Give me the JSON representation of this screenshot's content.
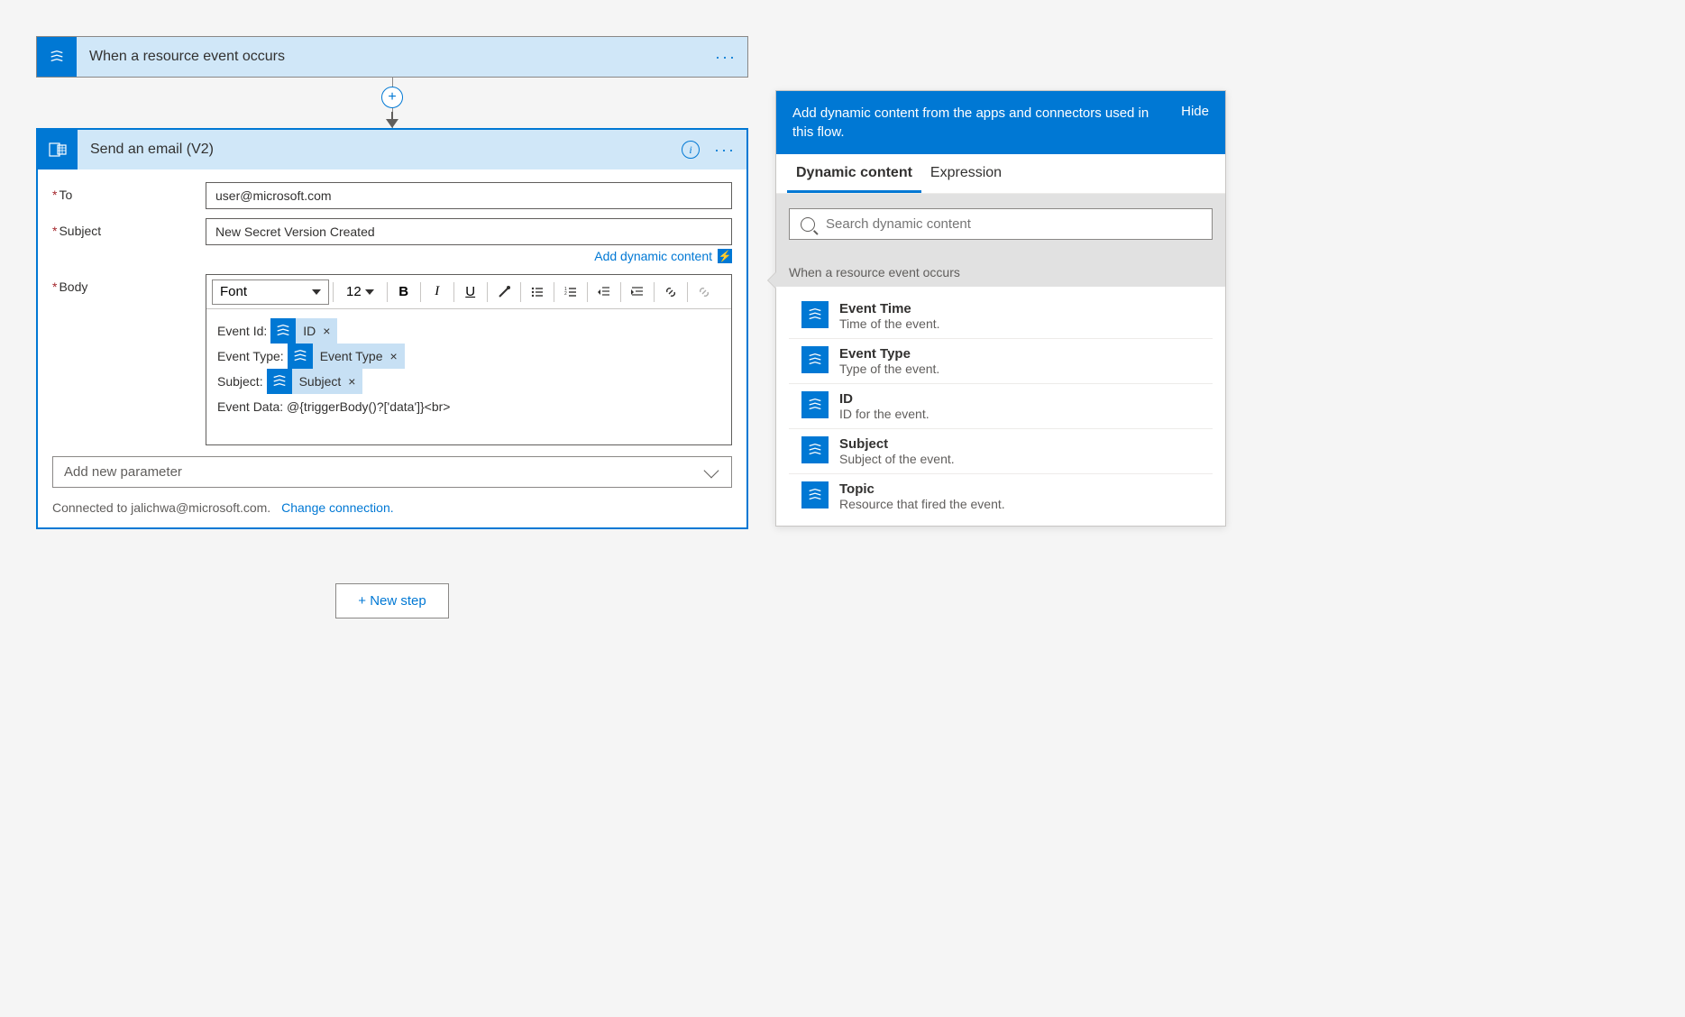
{
  "trigger": {
    "title": "When a resource event occurs"
  },
  "action": {
    "title": "Send an email (V2)",
    "fields": {
      "to_label": "To",
      "to_value": "user@microsoft.com",
      "subject_label": "Subject",
      "subject_value": "New Secret Version Created",
      "body_label": "Body"
    },
    "add_dynamic": "Add dynamic content",
    "toolbar": {
      "font": "Font",
      "size": "12"
    },
    "body_lines": {
      "l1_label": "Event Id:",
      "l1_token": "ID",
      "l2_label": "Event Type:",
      "l2_token": "Event Type",
      "l3_label": "Subject:",
      "l3_token": "Subject",
      "l4_text": "Event Data: @{triggerBody()?['data']}<br>"
    },
    "add_param": "Add new parameter",
    "connected_prefix": "Connected to jalichwa@microsoft.com.",
    "change_conn": "Change connection."
  },
  "new_step": "+ New step",
  "panel": {
    "head": "Add dynamic content from the apps and connectors used in this flow.",
    "hide": "Hide",
    "tabs": {
      "dynamic": "Dynamic content",
      "expression": "Expression"
    },
    "search_placeholder": "Search dynamic content",
    "section": "When a resource event occurs",
    "items": [
      {
        "title": "Event Time",
        "desc": "Time of the event."
      },
      {
        "title": "Event Type",
        "desc": "Type of the event."
      },
      {
        "title": "ID",
        "desc": "ID for the event."
      },
      {
        "title": "Subject",
        "desc": "Subject of the event."
      },
      {
        "title": "Topic",
        "desc": "Resource that fired the event."
      }
    ]
  }
}
